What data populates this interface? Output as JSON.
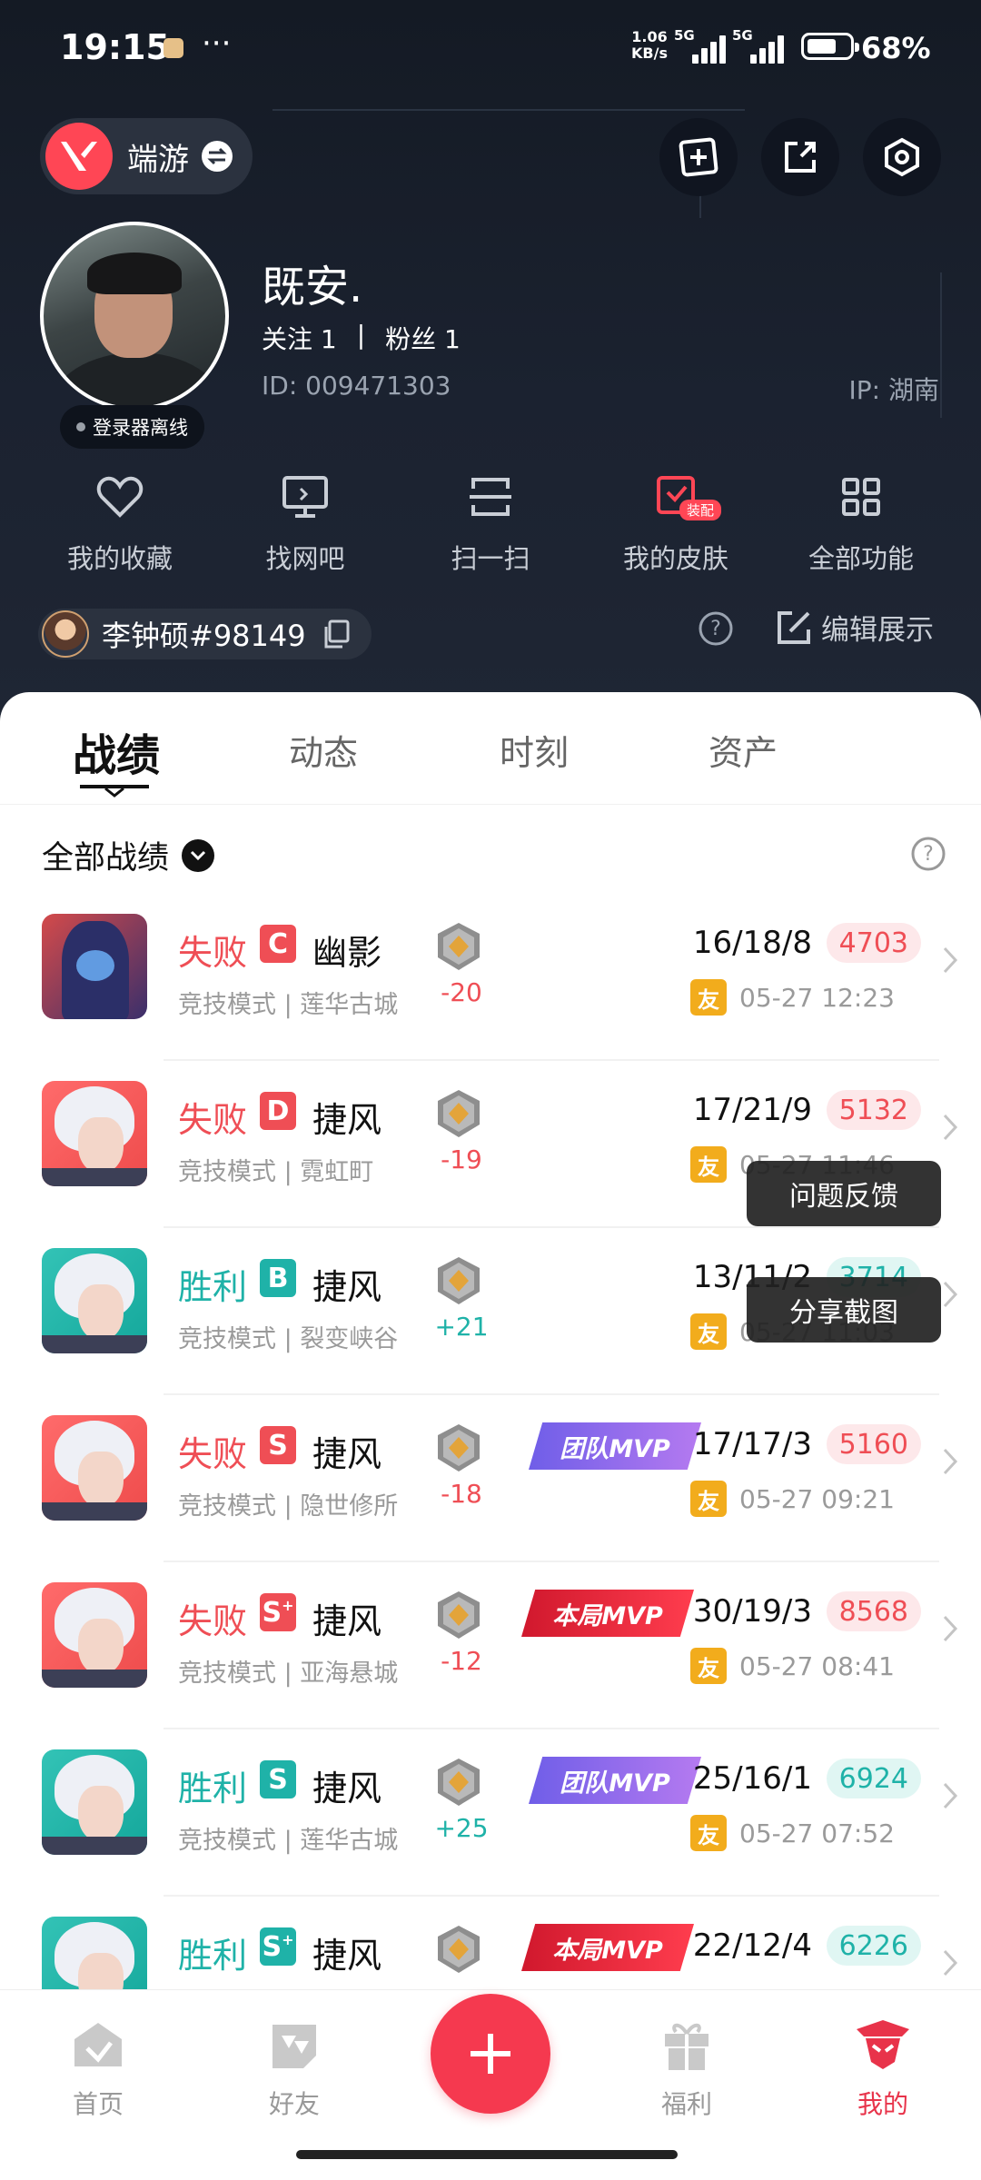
{
  "status_bar": {
    "time": "19:15",
    "dots": "···",
    "net_speed_line1": "1.06",
    "net_speed_line2": "KB/s",
    "signal_label": "5G",
    "battery_percent": "68%",
    "battery_level": 0.68
  },
  "header": {
    "game_name": "端游",
    "nickname": "既安.",
    "follow_label": "关注 1",
    "separator": "|",
    "fans_label": "粉丝 1",
    "user_id": "ID: 009471303",
    "ip_location": "IP: 湖南",
    "login_status": "登录器离线",
    "functions": [
      {
        "label": "我的收藏",
        "icon": "heart-icon"
      },
      {
        "label": "找网吧",
        "icon": "monitor-icon"
      },
      {
        "label": "扫一扫",
        "icon": "scan-icon"
      },
      {
        "label": "我的皮肤",
        "icon": "skin-icon",
        "tag": "装配"
      },
      {
        "label": "全部功能",
        "icon": "grid-icon"
      }
    ],
    "riot_id": "李钟硕#98149",
    "edit_display": "编辑展示"
  },
  "tabs": [
    "战绩",
    "动态",
    "时刻",
    "资产"
  ],
  "active_tab": "战绩",
  "filter_label": "全部战绩",
  "popup_menu": [
    "问题反馈",
    "分享截图"
  ],
  "matches": [
    {
      "result": "失败",
      "status": "lose",
      "grade": "C",
      "grade_plus": "",
      "agent": "幽影",
      "mode": "竞技模式 | 莲华古城",
      "rr": "-20",
      "mvp": "",
      "kda": "16/18/8",
      "score": "4703",
      "friend": "友",
      "time": "05-27 12:23",
      "thumb": "dark"
    },
    {
      "result": "失败",
      "status": "lose",
      "grade": "D",
      "grade_plus": "",
      "agent": "捷风",
      "mode": "竞技模式 | 霓虹町",
      "rr": "-19",
      "mvp": "",
      "kda": "17/21/9",
      "score": "5132",
      "friend": "友",
      "time": "05-27 11:46",
      "thumb": "red"
    },
    {
      "result": "胜利",
      "status": "win",
      "grade": "B",
      "grade_plus": "",
      "agent": "捷风",
      "mode": "竞技模式 | 裂变峡谷",
      "rr": "+21",
      "mvp": "",
      "kda": "13/11/2",
      "score": "3714",
      "friend": "友",
      "time": "05-27 11:03",
      "thumb": "teal"
    },
    {
      "result": "失败",
      "status": "lose",
      "grade": "S",
      "grade_plus": "",
      "agent": "捷风",
      "mode": "竞技模式 | 隐世修所",
      "rr": "-18",
      "mvp": "团队MVP",
      "mvp_type": "team",
      "kda": "17/17/3",
      "score": "5160",
      "friend": "友",
      "time": "05-27 09:21",
      "thumb": "red"
    },
    {
      "result": "失败",
      "status": "lose",
      "grade": "S",
      "grade_plus": "+",
      "agent": "捷风",
      "mode": "竞技模式 | 亚海悬城",
      "rr": "-12",
      "mvp": "本局MVP",
      "mvp_type": "match",
      "kda": "30/19/3",
      "score": "8568",
      "friend": "友",
      "time": "05-27 08:41",
      "thumb": "red"
    },
    {
      "result": "胜利",
      "status": "win",
      "grade": "S",
      "grade_plus": "",
      "agent": "捷风",
      "mode": "竞技模式 | 莲华古城",
      "rr": "+25",
      "mvp": "团队MVP",
      "mvp_type": "team",
      "kda": "25/16/1",
      "score": "6924",
      "friend": "友",
      "time": "05-27 07:52",
      "thumb": "teal"
    },
    {
      "result": "胜利",
      "status": "win",
      "grade": "S",
      "grade_plus": "+",
      "agent": "捷风",
      "mode": "",
      "rr": "",
      "mvp": "本局MVP",
      "mvp_type": "match",
      "kda": "22/12/4",
      "score": "6226",
      "friend": "",
      "time": "",
      "thumb": "teal"
    }
  ],
  "bottom_nav": [
    {
      "label": "首页",
      "icon": "home-icon"
    },
    {
      "label": "好友",
      "icon": "friends-icon"
    },
    {
      "label": "",
      "icon": "plus-icon"
    },
    {
      "label": "福利",
      "icon": "gift-icon"
    },
    {
      "label": "我的",
      "icon": "profile-icon"
    }
  ],
  "colors": {
    "accent": "#f5394f",
    "lose": "#ef4e55",
    "win": "#1fb2a8",
    "header_bg": "#1b2230"
  }
}
